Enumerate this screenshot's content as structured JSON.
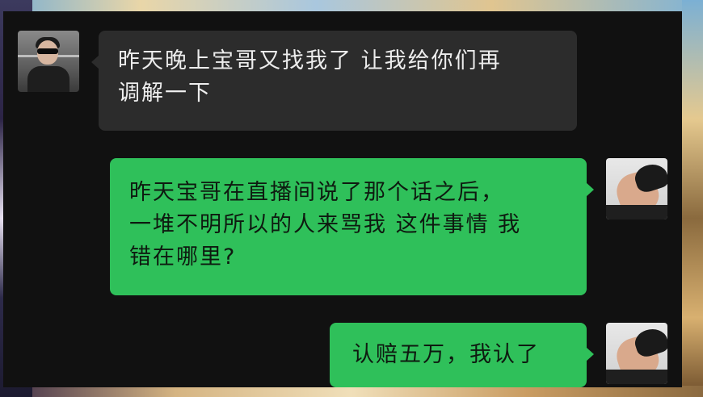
{
  "messages": [
    {
      "side": "left",
      "lines": [
        "昨天晚上宝哥又找我了  让我给你们再",
        "调解一下"
      ]
    },
    {
      "side": "right",
      "lines": [
        "昨天宝哥在直播间说了那个话之后，",
        "一堆不明所以的人来骂我 这件事情 我",
        "错在哪里?"
      ]
    },
    {
      "side": "right",
      "lines": [
        "认赔五万，我认了"
      ]
    }
  ],
  "colors": {
    "panel_background": "#111111",
    "incoming_bubble": "#2c2c2c",
    "outgoing_bubble": "#2fc05a"
  }
}
